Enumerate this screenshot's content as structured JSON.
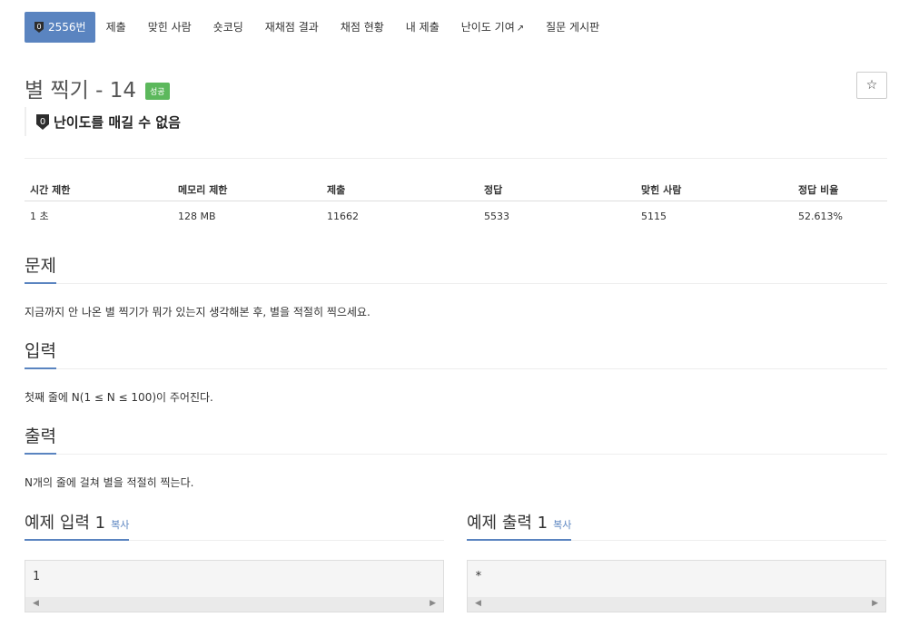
{
  "tabs": [
    {
      "label": "2556번",
      "active": true
    },
    {
      "label": "제출"
    },
    {
      "label": "맞힌 사람"
    },
    {
      "label": "숏코딩"
    },
    {
      "label": "재채점 결과"
    },
    {
      "label": "채점 현황"
    },
    {
      "label": "내 제출"
    },
    {
      "label": "난이도 기여"
    },
    {
      "label": "질문 게시판"
    }
  ],
  "problem": {
    "title": "별 찍기 - 14",
    "status_badge": "성공",
    "star_glyph": "☆",
    "tier_label": "난이도를 매길 수 없음",
    "tier_number": "0"
  },
  "info": {
    "headers": [
      "시간 제한",
      "메모리 제한",
      "제출",
      "정답",
      "맞힌 사람",
      "정답 비율"
    ],
    "values": [
      "1 초",
      "128 MB",
      "11662",
      "5533",
      "5115",
      "52.613%"
    ]
  },
  "sections": {
    "description": {
      "title": "문제",
      "text": "지금까지 안 나온 별 찍기가 뭐가 있는지 생각해본 후, 별을 적절히 찍으세요."
    },
    "input": {
      "title": "입력",
      "text": "첫째 줄에 N(1 ≤ N ≤ 100)이 주어진다."
    },
    "output": {
      "title": "출력",
      "text": "N개의 줄에 걸쳐 별을 적절히 찍는다."
    }
  },
  "samples": {
    "input": {
      "title": "예제 입력 1",
      "copy": "복사",
      "content": "1"
    },
    "output": {
      "title": "예제 출력 1",
      "copy": "복사",
      "content": "*"
    }
  },
  "colors": {
    "accent": "#5a84c0",
    "success": "#5cb85c"
  },
  "icons": {
    "tier": "tier-shield-icon",
    "external": "external-link-icon",
    "star": "star-icon"
  }
}
